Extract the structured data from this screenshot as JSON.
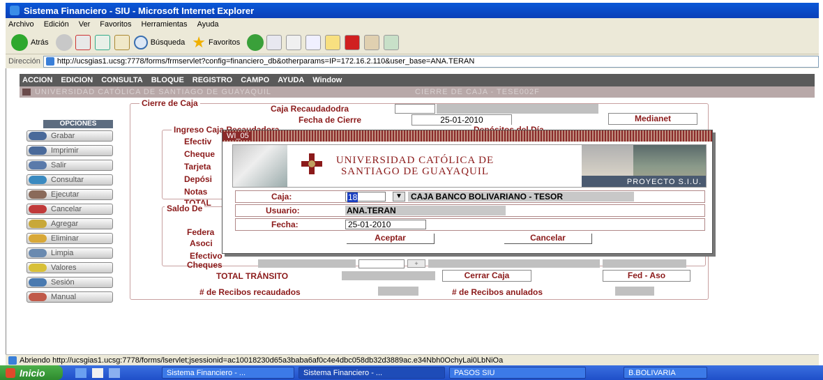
{
  "window": {
    "title": "Sistema Financiero - SIU - Microsoft Internet Explorer",
    "menu": [
      "Archivo",
      "Edición",
      "Ver",
      "Favoritos",
      "Herramientas",
      "Ayuda"
    ],
    "toolbar": {
      "back": "Atrás",
      "search": "Búsqueda",
      "favorites": "Favoritos"
    },
    "address_label": "Dirección",
    "address": "http://ucsgias1.ucsg:7778/forms/frmservlet?config=financiero_db&otherparams=IP=172.16.2.110&user_base=ANA.TERAN"
  },
  "forms": {
    "menu": [
      "ACCION",
      "EDICION",
      "CONSULTA",
      "BLOQUE",
      "REGISTRO",
      "CAMPO",
      "AYUDA",
      "Window"
    ],
    "header_left": "UNIVERSIDAD CATÓLICA DE SANTIAGO DE GUAYAQUIL",
    "header_right": "CIERRE DE CAJA - TESE002F"
  },
  "sidebar": {
    "title": "OPCIONES",
    "items": [
      "Grabar",
      "Imprimir",
      "Salir",
      "Consultar",
      "Ejecutar",
      "Cancelar",
      "Agregar",
      "Eliminar",
      "Limpia",
      "Valores",
      "Sesión",
      "Manual"
    ]
  },
  "form": {
    "group_title": "Cierre de Caja",
    "caja_label": "Caja Recaudadodra",
    "fecha_label": "Fecha de Cierre",
    "fecha_value": "25-01-2010",
    "medianet": "Medianet",
    "ingreso_title": "Ingreso Caja Recaudadora",
    "depositos_title": "Depósitos del Día",
    "ingreso_labels": [
      "Efectiv",
      "Cheque",
      "Tarjeta",
      "Depósi",
      "Notas",
      "TOTAL"
    ],
    "saldo_title": "Saldo De",
    "saldo_labels": [
      "Federa",
      "Asoci",
      "Efectivo",
      "Cheques"
    ],
    "total_transito": "TOTAL TRÁNSITO",
    "cerrar_caja": "Cerrar Caja",
    "fed_aso": "Fed - Aso",
    "recibos_recaudados": "# de Recibos recaudados",
    "recibos_anulados": "# de Recibos anulados"
  },
  "modal": {
    "title": "WI_05",
    "banner_line1": "UNIVERSIDAD CATÓLICA DE",
    "banner_line2": "SANTIAGO DE GUAYAQUIL",
    "banner_project": "PROYECTO S.I.U.",
    "caja_label": "Caja:",
    "caja_code": "18",
    "caja_name": "CAJA BANCO BOLIVARIANO - TESOR",
    "usuario_label": "Usuario:",
    "usuario_value": "ANA.TERAN",
    "fecha_label": "Fecha:",
    "fecha_value": "25-01-2010",
    "accept": "Aceptar",
    "cancel": "Cancelar"
  },
  "status": {
    "text": "Abriendo http://ucsgias1.ucsg:7778/forms/lservlet;jsessionid=ac10018230d65a3baba6af0c4e4dbc058db32d3889ac.e34Nbh0OchyLai0LbNiOa"
  },
  "taskbar": {
    "start": "Inicio",
    "tasks": [
      "Sistema Financiero - ...",
      "Sistema Financiero - ...",
      "PASOS SIU",
      "B.BOLIVARIA"
    ]
  },
  "colors": {
    "accent": "#8b1a1a",
    "titlebar": "#0a4fd0",
    "menu_bg": "#5a5a5a"
  }
}
